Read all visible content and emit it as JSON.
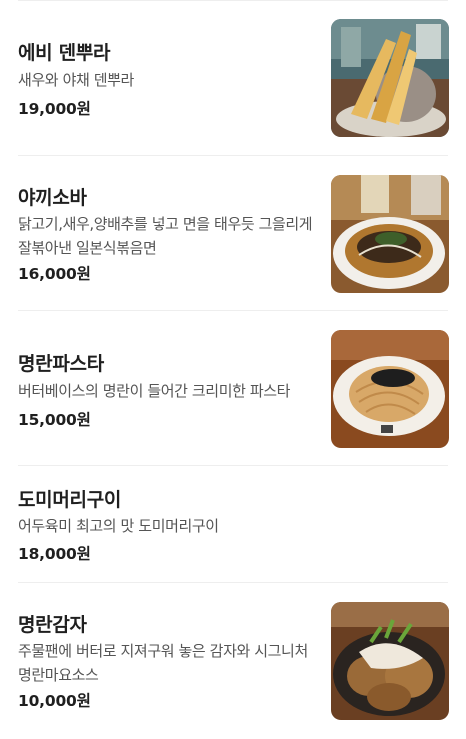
{
  "menu": [
    {
      "name": "에비 덴뿌라",
      "description": "새우와 야채 덴뿌라",
      "price": "19,000원",
      "image_icon": "tempura-photo"
    },
    {
      "name": "야끼소바",
      "description": "닭고기,새우,양배추를 넣고 면을 태우듯 그을리게 잘볶아낸 일본식볶음면",
      "price": "16,000원",
      "image_icon": "yakisoba-photo"
    },
    {
      "name": "명란파스타",
      "description": "버터베이스의 명란이 들어간 크리미한 파스타",
      "price": "15,000원",
      "image_icon": "mentaiko-pasta-photo"
    },
    {
      "name": "도미머리구이",
      "description": "어두육미 최고의 맛 도미머리구이",
      "price": "18,000원",
      "image_icon": null
    },
    {
      "name": "명란감자",
      "description": "주물팬에 버터로 지져구워 놓은 감자와 시그니처 명란마요소스",
      "price": "10,000원",
      "image_icon": "mentaiko-potato-photo"
    }
  ]
}
